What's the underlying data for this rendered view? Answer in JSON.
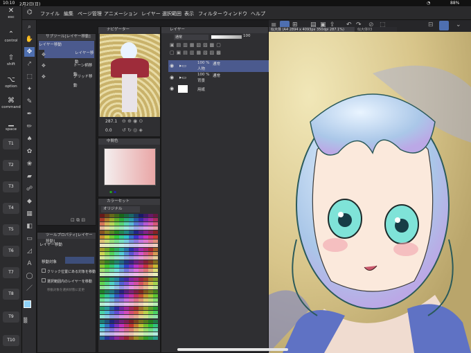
{
  "status": {
    "time": "10:10",
    "date": "2月2日(日)",
    "battery": "88%"
  },
  "menu": [
    "ファイル",
    "編集",
    "ページ管理",
    "アニメーション",
    "レイヤー",
    "選択範囲",
    "表示",
    "フィルター",
    "ウィンドウ",
    "ヘルプ"
  ],
  "left_keys": [
    {
      "label": "esc",
      "icon": "✕"
    },
    {
      "label": "control",
      "icon": "⌃"
    },
    {
      "label": "shift",
      "icon": "⇧"
    },
    {
      "label": "option",
      "icon": "⌥"
    },
    {
      "label": "command",
      "icon": "⌘"
    },
    {
      "label": "space",
      "icon": "▁"
    }
  ],
  "fkeys": [
    "T1",
    "T2",
    "T3",
    "T4",
    "T5",
    "T6",
    "T7",
    "T8",
    "T9",
    "T10"
  ],
  "subtool": {
    "header": "サブツール[レイヤー移動]",
    "group": "レイヤー移動",
    "items": [
      "レイヤー移動",
      "トーン柄移動",
      "グリッド移動"
    ]
  },
  "toolprop": {
    "header": "ツールプロパティ[レイヤー移動]",
    "title": "レイヤー移動",
    "target_label": "移動対象",
    "options": [
      "クリック位置にある対象を移動",
      "選択範囲内のレイヤーを移動",
      "移動対象を選択状態に変更"
    ]
  },
  "navigator": {
    "header": "ナビゲーター",
    "zoom": "287.1",
    "rotation": "0.0"
  },
  "intermediate": {
    "header": "中間色"
  },
  "colorset": {
    "header": "カラーセット",
    "name": "オリジナル"
  },
  "layers": {
    "header": "レイヤー",
    "blend": "通常",
    "opacity": "100",
    "items": [
      {
        "percent": "100 %",
        "mode": "通常",
        "name": "人物"
      },
      {
        "percent": "100 %",
        "mode": "通常",
        "name": "背景"
      },
      {
        "name": "用紙"
      }
    ]
  },
  "tabs": [
    "似大体 (A4 2894 x 4093px 350dpi 287.1%)",
    "似大体03"
  ]
}
